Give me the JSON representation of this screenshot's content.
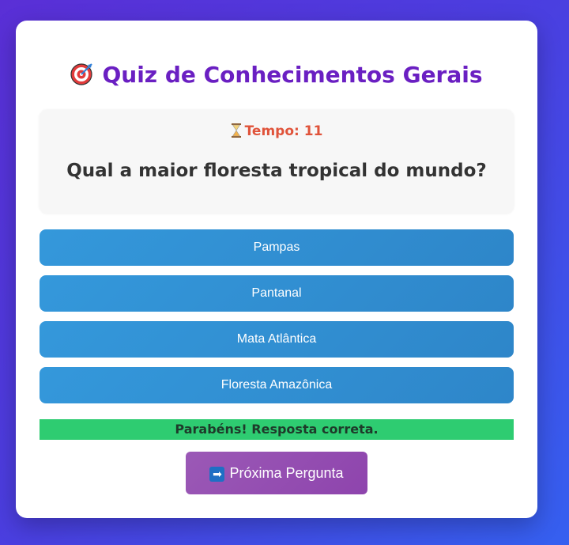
{
  "quiz": {
    "title": "Quiz de Conhecimentos Gerais",
    "timer_label": "Tempo: 11",
    "question": "Qual a maior floresta tropical do mundo?",
    "options": [
      "Pampas",
      "Pantanal",
      "Mata Atlântica",
      "Floresta Amazônica"
    ],
    "feedback": "Parabéns! Resposta correta.",
    "next_button": "Próxima Pergunta"
  },
  "icons": {
    "title": "target-icon",
    "timer": "hourglass-icon",
    "next": "arrow-right-icon"
  },
  "colors": {
    "title": "#6a1fc2",
    "timer": "#e0533a",
    "option": "#3498db",
    "feedback": "#2ecc71",
    "next_button": "#9b59b6"
  }
}
